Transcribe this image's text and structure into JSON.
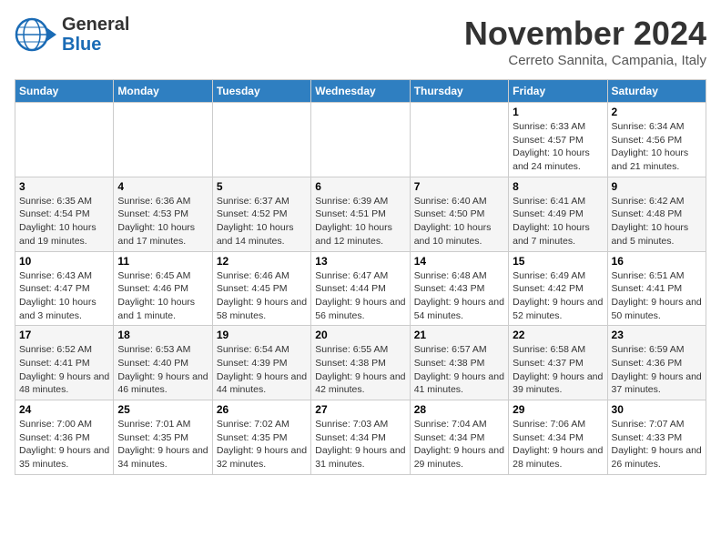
{
  "header": {
    "logo_line1": "General",
    "logo_line2": "Blue",
    "month_title": "November 2024",
    "location": "Cerreto Sannita, Campania, Italy"
  },
  "weekdays": [
    "Sunday",
    "Monday",
    "Tuesday",
    "Wednesday",
    "Thursday",
    "Friday",
    "Saturday"
  ],
  "weeks": [
    [
      {
        "day": "",
        "info": ""
      },
      {
        "day": "",
        "info": ""
      },
      {
        "day": "",
        "info": ""
      },
      {
        "day": "",
        "info": ""
      },
      {
        "day": "",
        "info": ""
      },
      {
        "day": "1",
        "info": "Sunrise: 6:33 AM\nSunset: 4:57 PM\nDaylight: 10 hours and 24 minutes."
      },
      {
        "day": "2",
        "info": "Sunrise: 6:34 AM\nSunset: 4:56 PM\nDaylight: 10 hours and 21 minutes."
      }
    ],
    [
      {
        "day": "3",
        "info": "Sunrise: 6:35 AM\nSunset: 4:54 PM\nDaylight: 10 hours and 19 minutes."
      },
      {
        "day": "4",
        "info": "Sunrise: 6:36 AM\nSunset: 4:53 PM\nDaylight: 10 hours and 17 minutes."
      },
      {
        "day": "5",
        "info": "Sunrise: 6:37 AM\nSunset: 4:52 PM\nDaylight: 10 hours and 14 minutes."
      },
      {
        "day": "6",
        "info": "Sunrise: 6:39 AM\nSunset: 4:51 PM\nDaylight: 10 hours and 12 minutes."
      },
      {
        "day": "7",
        "info": "Sunrise: 6:40 AM\nSunset: 4:50 PM\nDaylight: 10 hours and 10 minutes."
      },
      {
        "day": "8",
        "info": "Sunrise: 6:41 AM\nSunset: 4:49 PM\nDaylight: 10 hours and 7 minutes."
      },
      {
        "day": "9",
        "info": "Sunrise: 6:42 AM\nSunset: 4:48 PM\nDaylight: 10 hours and 5 minutes."
      }
    ],
    [
      {
        "day": "10",
        "info": "Sunrise: 6:43 AM\nSunset: 4:47 PM\nDaylight: 10 hours and 3 minutes."
      },
      {
        "day": "11",
        "info": "Sunrise: 6:45 AM\nSunset: 4:46 PM\nDaylight: 10 hours and 1 minute."
      },
      {
        "day": "12",
        "info": "Sunrise: 6:46 AM\nSunset: 4:45 PM\nDaylight: 9 hours and 58 minutes."
      },
      {
        "day": "13",
        "info": "Sunrise: 6:47 AM\nSunset: 4:44 PM\nDaylight: 9 hours and 56 minutes."
      },
      {
        "day": "14",
        "info": "Sunrise: 6:48 AM\nSunset: 4:43 PM\nDaylight: 9 hours and 54 minutes."
      },
      {
        "day": "15",
        "info": "Sunrise: 6:49 AM\nSunset: 4:42 PM\nDaylight: 9 hours and 52 minutes."
      },
      {
        "day": "16",
        "info": "Sunrise: 6:51 AM\nSunset: 4:41 PM\nDaylight: 9 hours and 50 minutes."
      }
    ],
    [
      {
        "day": "17",
        "info": "Sunrise: 6:52 AM\nSunset: 4:41 PM\nDaylight: 9 hours and 48 minutes."
      },
      {
        "day": "18",
        "info": "Sunrise: 6:53 AM\nSunset: 4:40 PM\nDaylight: 9 hours and 46 minutes."
      },
      {
        "day": "19",
        "info": "Sunrise: 6:54 AM\nSunset: 4:39 PM\nDaylight: 9 hours and 44 minutes."
      },
      {
        "day": "20",
        "info": "Sunrise: 6:55 AM\nSunset: 4:38 PM\nDaylight: 9 hours and 42 minutes."
      },
      {
        "day": "21",
        "info": "Sunrise: 6:57 AM\nSunset: 4:38 PM\nDaylight: 9 hours and 41 minutes."
      },
      {
        "day": "22",
        "info": "Sunrise: 6:58 AM\nSunset: 4:37 PM\nDaylight: 9 hours and 39 minutes."
      },
      {
        "day": "23",
        "info": "Sunrise: 6:59 AM\nSunset: 4:36 PM\nDaylight: 9 hours and 37 minutes."
      }
    ],
    [
      {
        "day": "24",
        "info": "Sunrise: 7:00 AM\nSunset: 4:36 PM\nDaylight: 9 hours and 35 minutes."
      },
      {
        "day": "25",
        "info": "Sunrise: 7:01 AM\nSunset: 4:35 PM\nDaylight: 9 hours and 34 minutes."
      },
      {
        "day": "26",
        "info": "Sunrise: 7:02 AM\nSunset: 4:35 PM\nDaylight: 9 hours and 32 minutes."
      },
      {
        "day": "27",
        "info": "Sunrise: 7:03 AM\nSunset: 4:34 PM\nDaylight: 9 hours and 31 minutes."
      },
      {
        "day": "28",
        "info": "Sunrise: 7:04 AM\nSunset: 4:34 PM\nDaylight: 9 hours and 29 minutes."
      },
      {
        "day": "29",
        "info": "Sunrise: 7:06 AM\nSunset: 4:34 PM\nDaylight: 9 hours and 28 minutes."
      },
      {
        "day": "30",
        "info": "Sunrise: 7:07 AM\nSunset: 4:33 PM\nDaylight: 9 hours and 26 minutes."
      }
    ]
  ]
}
